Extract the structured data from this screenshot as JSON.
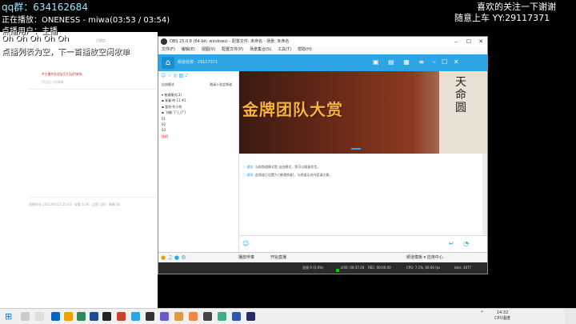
{
  "overlay": {
    "qq_group": "qq群：634162684",
    "now_playing": "正在播放：ONENESS - miwa(03:53 / 03:54)",
    "requester": "点播用户：主播",
    "ohs": "Oh Oh Oh Oh Oh",
    "queue_empty": "点播列表为空，下一首播放空闲歌单",
    "welcome": "喜欢的关注一下谢谢",
    "random_car": "随意上车 YY:29117371"
  },
  "obs": {
    "title": "OBS 25.0.8 (64-bit, windows) - 配置文件: 未命名 - 场景: 未命名",
    "menu": [
      "文件(F)",
      "编辑(E)",
      "视图(V)",
      "配置文件(P)",
      "场景集合(S)",
      "工具(T)",
      "帮助(H)"
    ],
    "status": {
      "dropped": "丢帧 0 (0.0%)",
      "live": "LIVE: 00:37:28",
      "rec": "REC: 00:00:00",
      "cpu": "CPU: 7.1%, 60.00 fps",
      "bitrate": "kb/s: 3677"
    }
  },
  "yy": {
    "room": "频道名称 · 29117371",
    "mode": "自由模式",
    "invite": "邀请入驻此频道",
    "list": [
      {
        "text": "▾ 普通模式(3)",
        "red": false
      },
      {
        "text": "  ▪ 青春·咚 11 #1",
        "red": false
      },
      {
        "text": "  ▪ 冒泡·冬小秀",
        "red": false
      },
      {
        "text": "  ▪ 飞蛾(ˇ?ˇ)_(?ˇ)",
        "red": false
      },
      {
        "text": "01",
        "red": false
      },
      {
        "text": "02",
        "red": false
      },
      {
        "text": "03",
        "red": false
      },
      {
        "text": "挂机",
        "red": true
      }
    ],
    "banner_text": "金牌团队大赏",
    "scroll_text": "天命圆",
    "notice1_label": "通知:",
    "notice1": "当前频道模式是 自由模式，您可以随意发言。",
    "notice2_label": "通知:",
    "notice2": "此频道已设置为 [普通频道]，与频道无关内容请注意。",
    "toolbar": {
      "song": "播放伴奏",
      "live": "开始直播",
      "right": "频道模板 ▾   应用中心"
    }
  },
  "left_chat": {
    "line1": "#主播#欢迎宝贝们[gif]来啦",
    "line2": "[欢迎]一起嗨嗨",
    "stats": "直播时长 2021/06/15 25:03 · 观看 6.3K · 点赞 184 · 弹幕 66",
    "lock": "已锁定"
  },
  "taskbar": {
    "clock_time": "14:32",
    "clock_date": "CPU温度"
  }
}
